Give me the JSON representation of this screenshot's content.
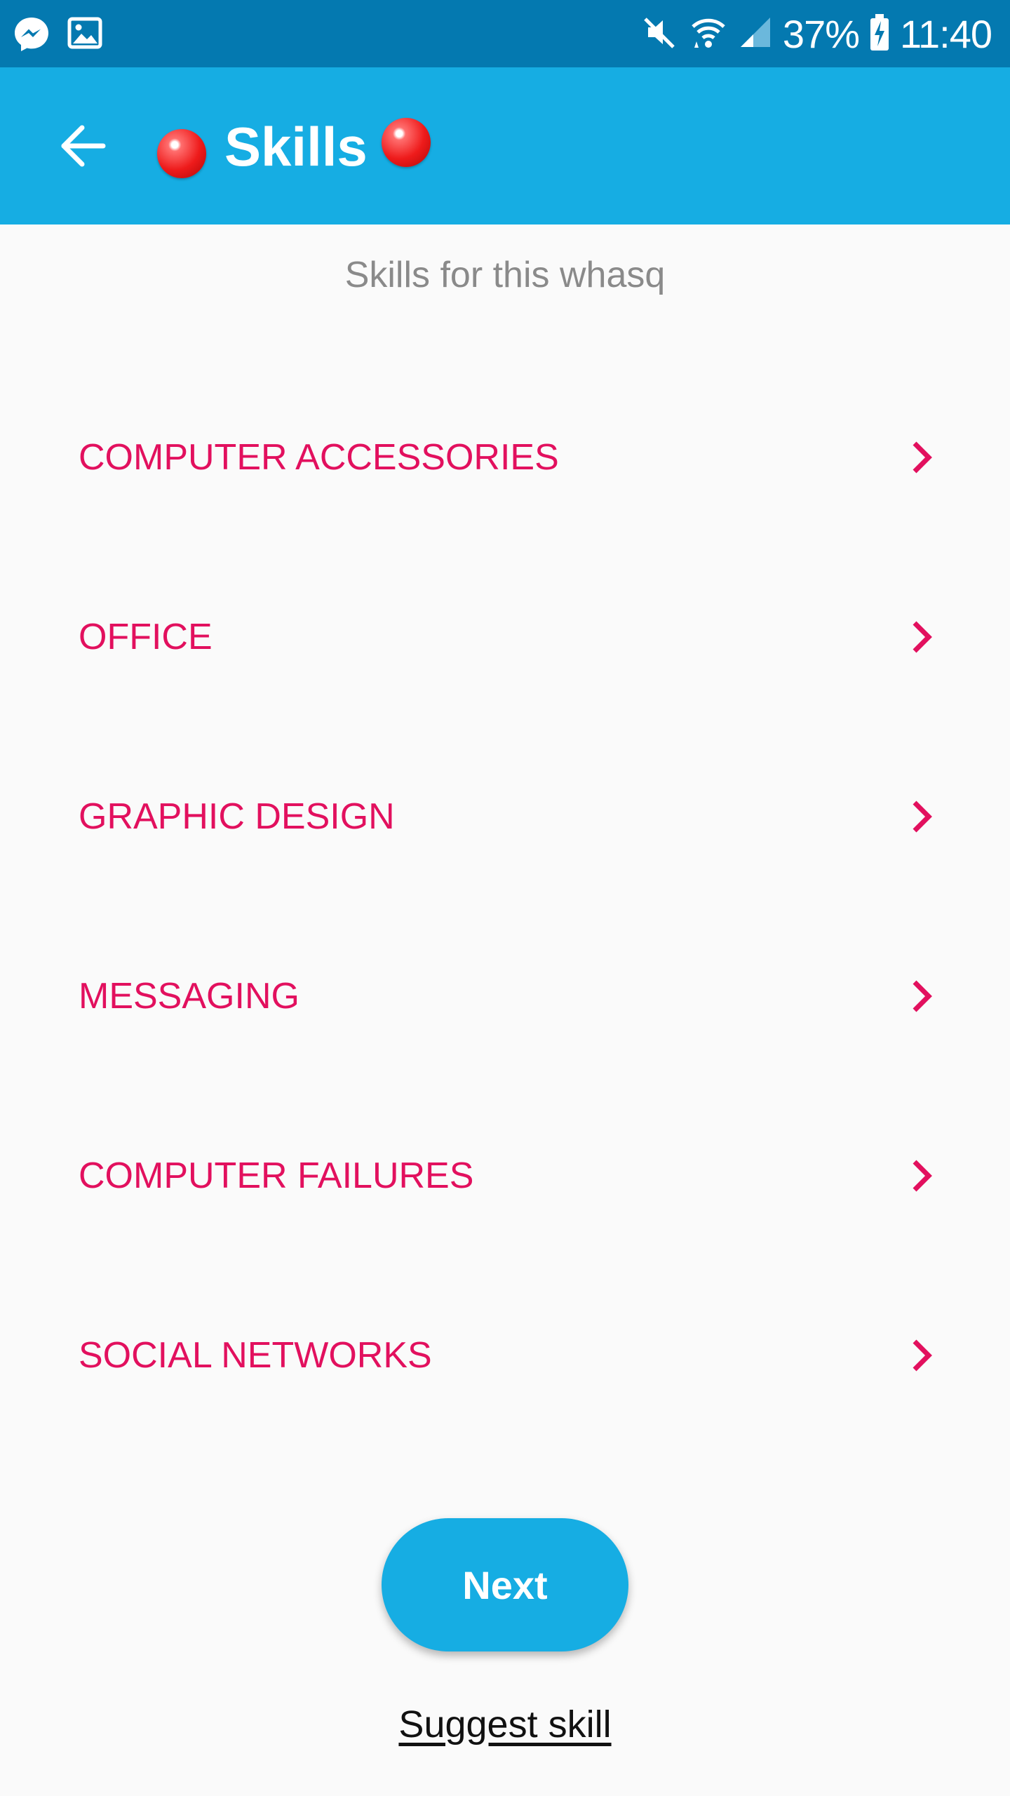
{
  "status_bar": {
    "battery": "37%",
    "time": "11:40",
    "icons": [
      "messenger-icon",
      "gallery-icon",
      "mute-icon",
      "wifi-icon",
      "signal-icon",
      "battery-charging-icon"
    ]
  },
  "app_bar": {
    "title": "Skills",
    "back_icon": "arrow-left-icon",
    "background_color": "#16ade3"
  },
  "subtitle": "Skills for this whasq",
  "skills": [
    {
      "label": "COMPUTER ACCESSORIES"
    },
    {
      "label": "OFFICE"
    },
    {
      "label": "GRAPHIC DESIGN"
    },
    {
      "label": "MESSAGING"
    },
    {
      "label": "COMPUTER FAILURES"
    },
    {
      "label": "SOCIAL NETWORKS"
    }
  ],
  "actions": {
    "next_label": "Next",
    "suggest_label": "Suggest skill"
  },
  "colors": {
    "status_bar": "#0479b0",
    "accent": "#16ade3",
    "skill_text": "#e2105e",
    "background": "#fafafa"
  }
}
